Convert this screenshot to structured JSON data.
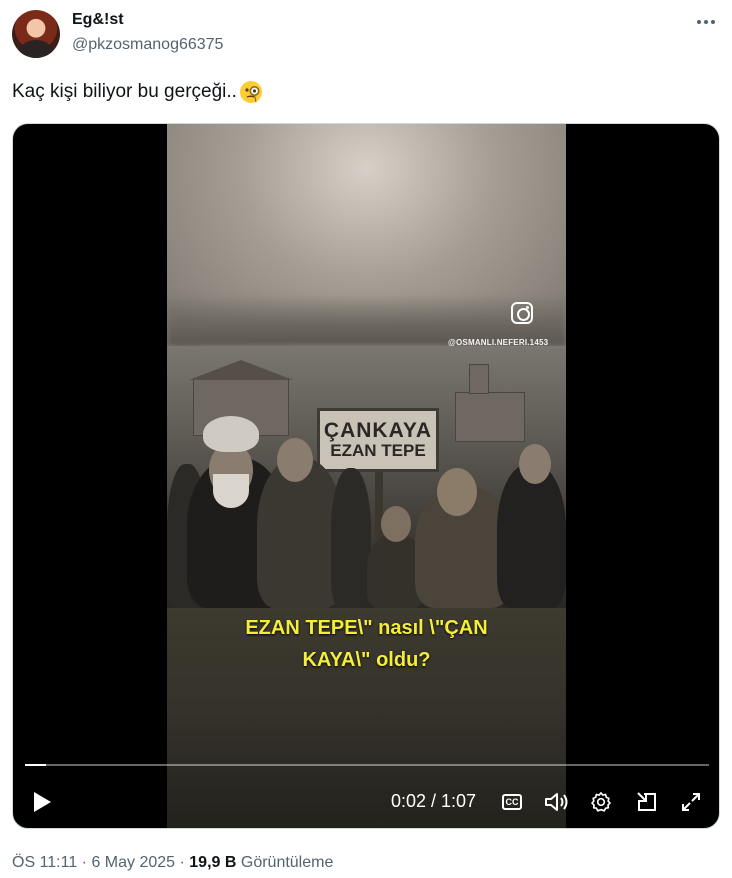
{
  "post": {
    "display_name": "Eg&!st",
    "handle": "@pkzosmanog66375",
    "text": "Kaç kişi biliyor bu gerçeği..",
    "emoji_icon": "face-with-monocle-icon"
  },
  "video": {
    "sign_line1": "ÇANKAYA",
    "sign_line2": "EZAN TEPE",
    "watermark": "@OSMANLI.NEFERI.1453",
    "caption_line1": "EZAN TEPE\\\" nasıl \\\"ÇAN",
    "caption_line2": "KAYA\\\" oldu?",
    "caption_color": "#f4ee3a",
    "time_display": "0:02 / 1:07",
    "progress": 0.031
  },
  "meta": {
    "timestamp": "ÖS 11:11 · 6 May 2025 · ",
    "views_count": "19,9 B",
    "views_label": " Görüntüleme"
  }
}
